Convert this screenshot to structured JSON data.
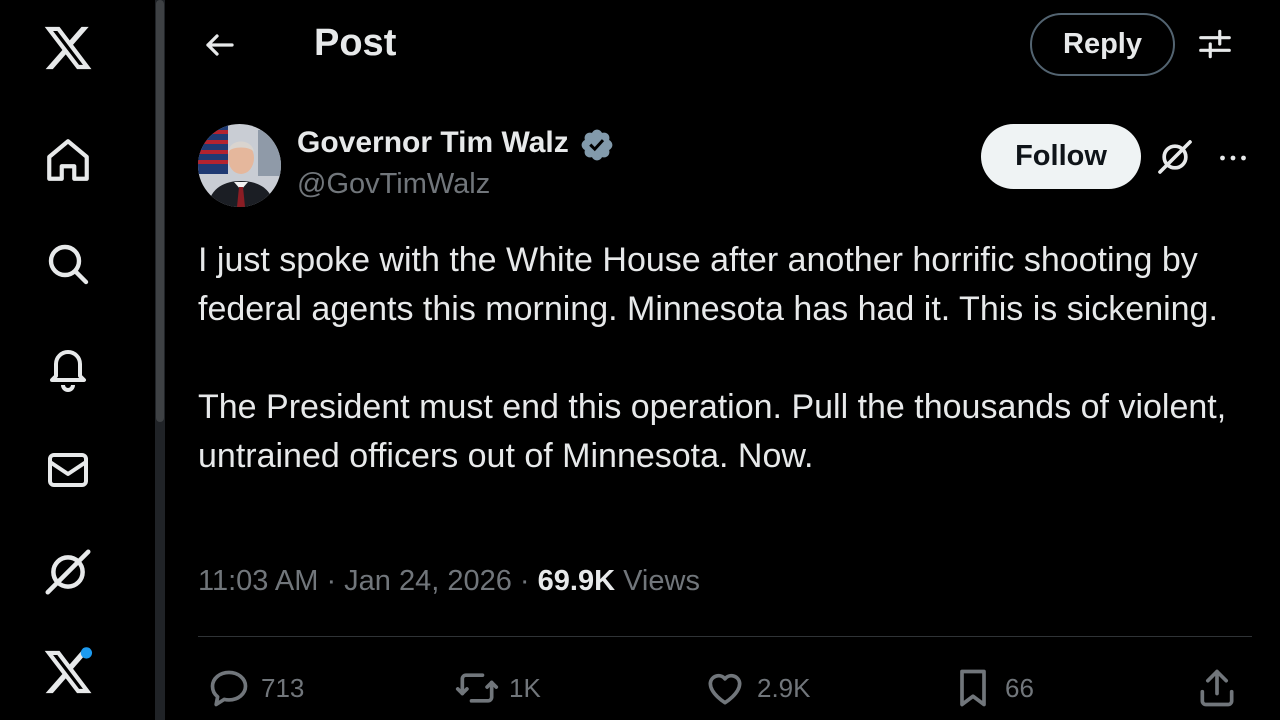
{
  "sidebar": {
    "items": [
      {
        "name": "x-logo"
      },
      {
        "name": "home"
      },
      {
        "name": "explore"
      },
      {
        "name": "notifications"
      },
      {
        "name": "messages"
      },
      {
        "name": "grok"
      },
      {
        "name": "premium"
      }
    ]
  },
  "header": {
    "title": "Post",
    "reply_label": "Reply"
  },
  "author": {
    "name": "Governor Tim Walz",
    "handle": "@GovTimWalz",
    "verified": true,
    "follow_label": "Follow"
  },
  "tweet": {
    "paragraphs": [
      "I just spoke with the White House after another horrific shooting by federal agents this morning. Minnesota has had it. This is sickening.",
      "The President must end this operation. Pull the thousands of violent, untrained officers out of Minnesota. Now."
    ],
    "time": "11:03 AM",
    "separator": " · ",
    "date": "Jan 24, 2026",
    "views_count": "69.9K",
    "views_label": "Views"
  },
  "actions": {
    "replies": "713",
    "reposts": "1K",
    "likes": "2.9K",
    "bookmarks": "66"
  },
  "colors": {
    "background": "#000000",
    "text": "#e7e9ea",
    "muted": "#71767b",
    "verified_badge": "#829aab",
    "notification_dot": "#1d9bf0"
  }
}
